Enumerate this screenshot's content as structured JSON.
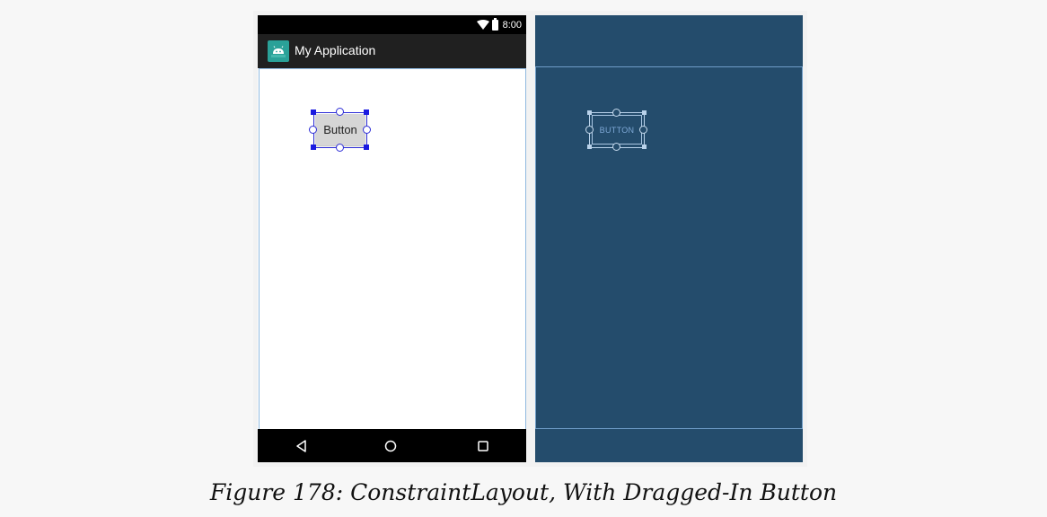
{
  "status_bar": {
    "time": "8:00",
    "icons": [
      "wifi-icon",
      "battery-icon"
    ]
  },
  "app_bar": {
    "title": "My Application",
    "icon": "android-app-icon"
  },
  "design_view": {
    "button_label": "Button"
  },
  "blueprint_view": {
    "button_label": "BUTTON"
  },
  "nav_bar": {
    "icons": [
      "back-icon",
      "home-icon",
      "recents-icon"
    ]
  },
  "caption": "Figure 178: ConstraintLayout, With Dragged-In Button",
  "colors": {
    "blueprint_bg": "#244c6c",
    "selection": "#2c2cd6",
    "app_icon": "#2aa198"
  }
}
